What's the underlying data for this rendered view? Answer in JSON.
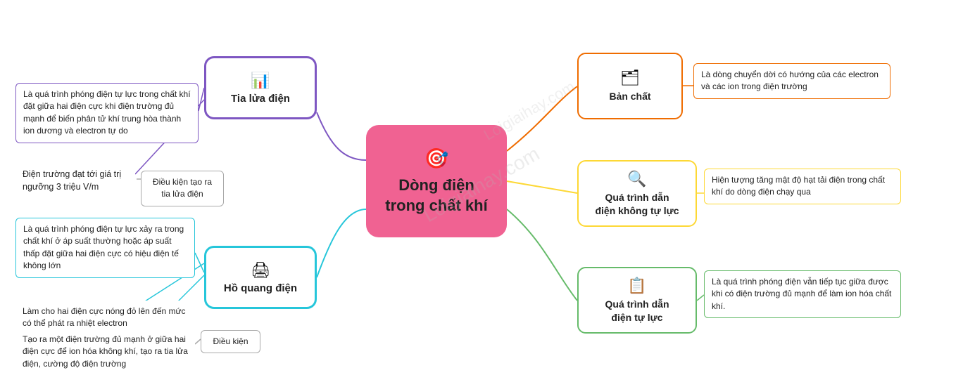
{
  "watermark": "Loigiaihay.com",
  "central": {
    "icon": "🎯",
    "title": "Dòng điện\ntrong chất khí"
  },
  "branches": {
    "tia_lua_dien": {
      "icon": "📊",
      "label": "Tia lửa điện"
    },
    "ho_quang_dien": {
      "icon": "🖨",
      "label": "Hồ quang điện"
    }
  },
  "right_nodes": {
    "ban_chat": {
      "icon": "🗂",
      "label": "Bản chất"
    },
    "qua_trinh_khong_tu_luc": {
      "icon": "🔍",
      "label": "Quá trình dẫn\nđiện không tự lực"
    },
    "qua_trinh_tu_luc": {
      "icon": "📋",
      "label": "Quá trình dẫn\nđiện tự lực"
    }
  },
  "info_boxes": {
    "tia_main": "Là quá trình phóng điện tự lực trong chất khí đặt giữa hai điện cực khi điện trường đủ mạnh để biến phân tử khí trung hòa thành ion dương và electron tự do",
    "tia_nguong": "Điện trường đạt tới giá trị\nngưỡng 3 triệu V/m",
    "tia_dieu_kien": "Điều kiện tạo ra tia lửa điện",
    "ho_main": "Là quá trình phóng điện tự lực xảy ra trong chất khí ở áp suất thường hoặc áp suất thấp đặt giữa hai điện cực có hiệu điện tế không lớn",
    "ho_lam": "Làm cho hai điện cực nóng đỏ lên\nđến mức có thể phát ra nhiệt electron",
    "ho_tao": "Tạo ra một điện trường đủ mạnh ở\ngiữa hai điện cực để ion hóa không\nkhí, tạo ra tia lửa điện, cường độ điện\ntrường",
    "ho_dieu_kien": "Điều kiện",
    "ban_chat_desc": "Là dòng chuyển dời có hướng của các electron\nvà các ion trong điện trường",
    "qua_trinh_khong_desc": "Hiện tượng tăng mật độ hạt tải điện\ntrong  chất khí do dòng điện chạy qua",
    "qua_trinh_tu_desc": "Là quá trình phóng điện vẫn tiếp tục\ngiữa được khi có điện trường đủ mạnh\nđể làm ion hóa chất khí."
  }
}
